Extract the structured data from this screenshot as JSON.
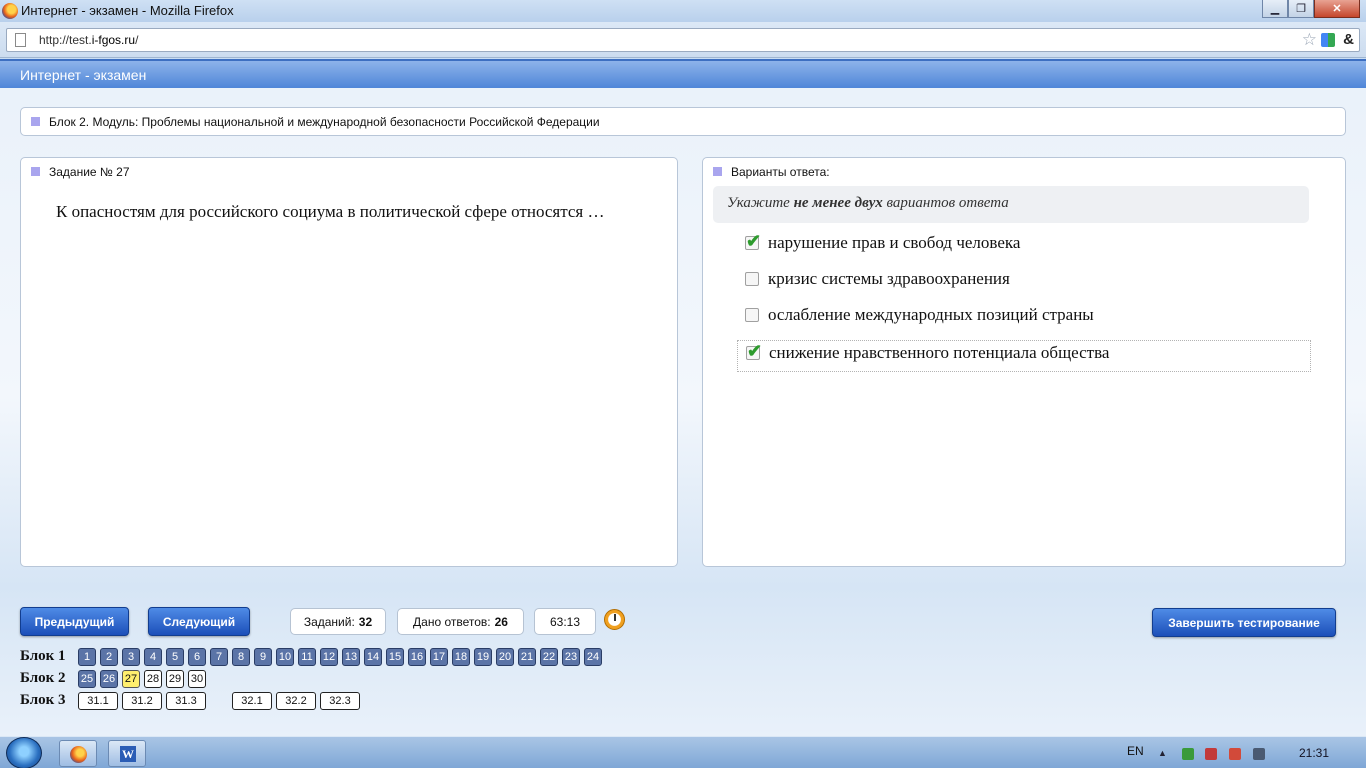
{
  "window": {
    "title": "Интернет - экзамен - Mozilla Firefox"
  },
  "browser": {
    "url_prefix": "http://test.",
    "url_domain": "i-fgos.ru",
    "url_suffix": "/"
  },
  "app": {
    "header": "Интернет - экзамен"
  },
  "block_title": "Блок 2. Модуль: Проблемы национальной и международной безопасности Российской Федерации",
  "task": {
    "label": "Задание № 27",
    "question": "К опасностям для российского социума в политической сфере относятся …"
  },
  "answers": {
    "label": "Варианты ответа:",
    "hint_pre": "Укажите ",
    "hint_bold": "не менее двух",
    "hint_post": " вариантов ответа",
    "options": [
      {
        "text": "нарушение прав и свобод человека",
        "checked": true
      },
      {
        "text": "кризис системы здравоохранения",
        "checked": false
      },
      {
        "text": "ослабление международных позиций страны",
        "checked": false
      },
      {
        "text": "снижение нравственного потенциала общества",
        "checked": true
      }
    ]
  },
  "controls": {
    "prev": "Предыдущий",
    "next": "Следующий",
    "tasks_label": "Заданий:",
    "tasks_count": "32",
    "answered_label": "Дано ответов:",
    "answered_count": "26",
    "timer": "63:13",
    "finish": "Завершить тестирование"
  },
  "blocks": [
    {
      "label": "Блок 1",
      "items": [
        "1",
        "2",
        "3",
        "4",
        "5",
        "6",
        "7",
        "8",
        "9",
        "10",
        "11",
        "12",
        "13",
        "14",
        "15",
        "16",
        "17",
        "18",
        "19",
        "20",
        "21",
        "22",
        "23",
        "24"
      ]
    },
    {
      "label": "Блок 2",
      "items": [
        "25",
        "26",
        "27",
        "28",
        "29",
        "30"
      ]
    },
    {
      "label": "Блок 3",
      "items": [
        "31.1",
        "31.2",
        "31.3",
        "32.1",
        "32.2",
        "32.3"
      ]
    }
  ],
  "block_status": {
    "done": [
      "1",
      "2",
      "3",
      "4",
      "5",
      "6",
      "7",
      "8",
      "9",
      "10",
      "11",
      "12",
      "13",
      "14",
      "15",
      "16",
      "17",
      "18",
      "19",
      "20",
      "21",
      "22",
      "23",
      "24",
      "25",
      "26"
    ],
    "current": "27"
  },
  "taskbar": {
    "lang": "EN",
    "clock": "21:31"
  }
}
